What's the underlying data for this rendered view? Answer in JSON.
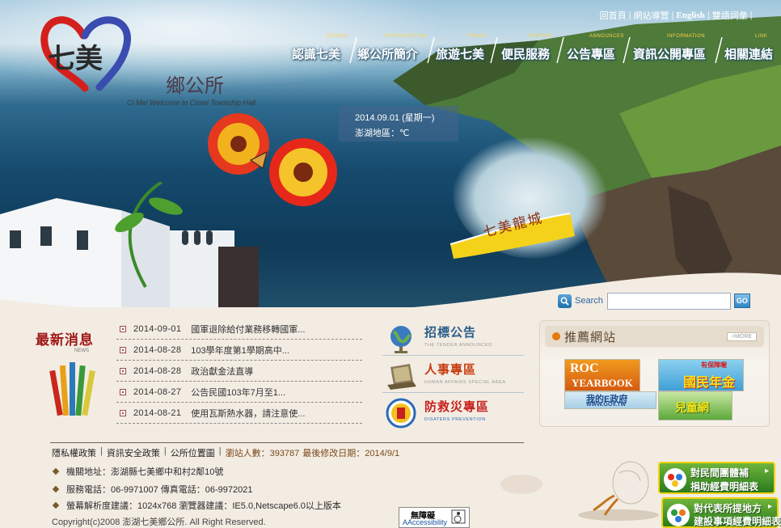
{
  "site": {
    "logo_name": "鄉公所",
    "logo_subtitle": "Ci Mei  Welcome to Cimei Township Hall"
  },
  "toplinks": [
    "回首頁",
    "網站導覽",
    "English",
    "雙語詞彙"
  ],
  "nav": [
    {
      "en": "DESIGN",
      "zh": "認識七美"
    },
    {
      "en": "INTRODUCTION",
      "zh": "鄉公所簡介"
    },
    {
      "en": "TRAVEL",
      "zh": "旅遊七美"
    },
    {
      "en": "SERVICE",
      "zh": "便民服務"
    },
    {
      "en": "ANNOUNCES",
      "zh": "公告專區"
    },
    {
      "en": "INFORMATION",
      "zh": "資訊公開專區"
    },
    {
      "en": "LINK",
      "zh": "相關連結"
    }
  ],
  "date": "2014.09.01 (星期一)",
  "weather": "澎湖地區：℃",
  "banner_text": "七美龍城",
  "search": {
    "label": "Search",
    "value": "",
    "go": "GO"
  },
  "news": {
    "title": "最新消息",
    "subtitle": "NEWS",
    "items": [
      {
        "date": "2014-09-01",
        "text": "國軍退除給付業務移轉國軍..."
      },
      {
        "date": "2014-08-28",
        "text": "103學年度第1學期高中..."
      },
      {
        "date": "2014-08-28",
        "text": "政治獻金法直導"
      },
      {
        "date": "2014-08-27",
        "text": "公告民國103年7月至1..."
      },
      {
        "date": "2014-08-21",
        "text": "使用瓦斯熱水器，請注意使..."
      }
    ]
  },
  "announcements": [
    {
      "zh": "招標公告",
      "en": "THE TENDER ANNOUNCED",
      "color": "#2a5d8a",
      "icon": "globe-icon"
    },
    {
      "zh": "人事專區",
      "en": "HUMAN AFFAIRS SPECIAL AREA",
      "color": "#c63a0e",
      "icon": "laptop-icon"
    },
    {
      "zh": "防救災專區",
      "en": "DISATERS PREVENTION",
      "color": "#c8201c",
      "icon": "disaster-icon"
    }
  ],
  "recommended": {
    "title": "推薦網站",
    "more": "+MORE",
    "sites": [
      {
        "name": "ROC YEARBOOK",
        "line1": "ROC",
        "line2": "YEARBOOK"
      },
      {
        "name": "我的E政府",
        "line1": "我的E政府",
        "line2": "WWW.GOV.TW"
      },
      {
        "name": "國民年金",
        "line1": "國民年金",
        "line2": "有保障喔"
      },
      {
        "name": "兒童網",
        "line1": "兒童網",
        "line2": ""
      }
    ]
  },
  "footer": {
    "links": [
      "隱私權政策",
      "資訊安全政策",
      "公所位置圖"
    ],
    "visitors_label": "瀏站人數：393787",
    "updated_label": "最後修改日期：2014/9/1",
    "address": "機關地址：澎湖縣七美鄉中和村2鄰10號",
    "phone": "服務電話：06-9971007  傳真電話：06-9972021",
    "resolution": "螢幕解析度建議：1024x768  瀏覽器建議：IE5.0,Netscape6.0以上版本",
    "copyright": "Copyright(c)2008  澎湖七美鄉公所.  All  Right  Reserved."
  },
  "accessibility": {
    "zh": "無障礙",
    "en": "AAccessibility"
  },
  "side_buttons": [
    {
      "line1": "對民間團體補",
      "line2": "捐助經費明細表"
    },
    {
      "line1": "對代表所提地方",
      "line2": "建設事項經費明細表"
    }
  ]
}
